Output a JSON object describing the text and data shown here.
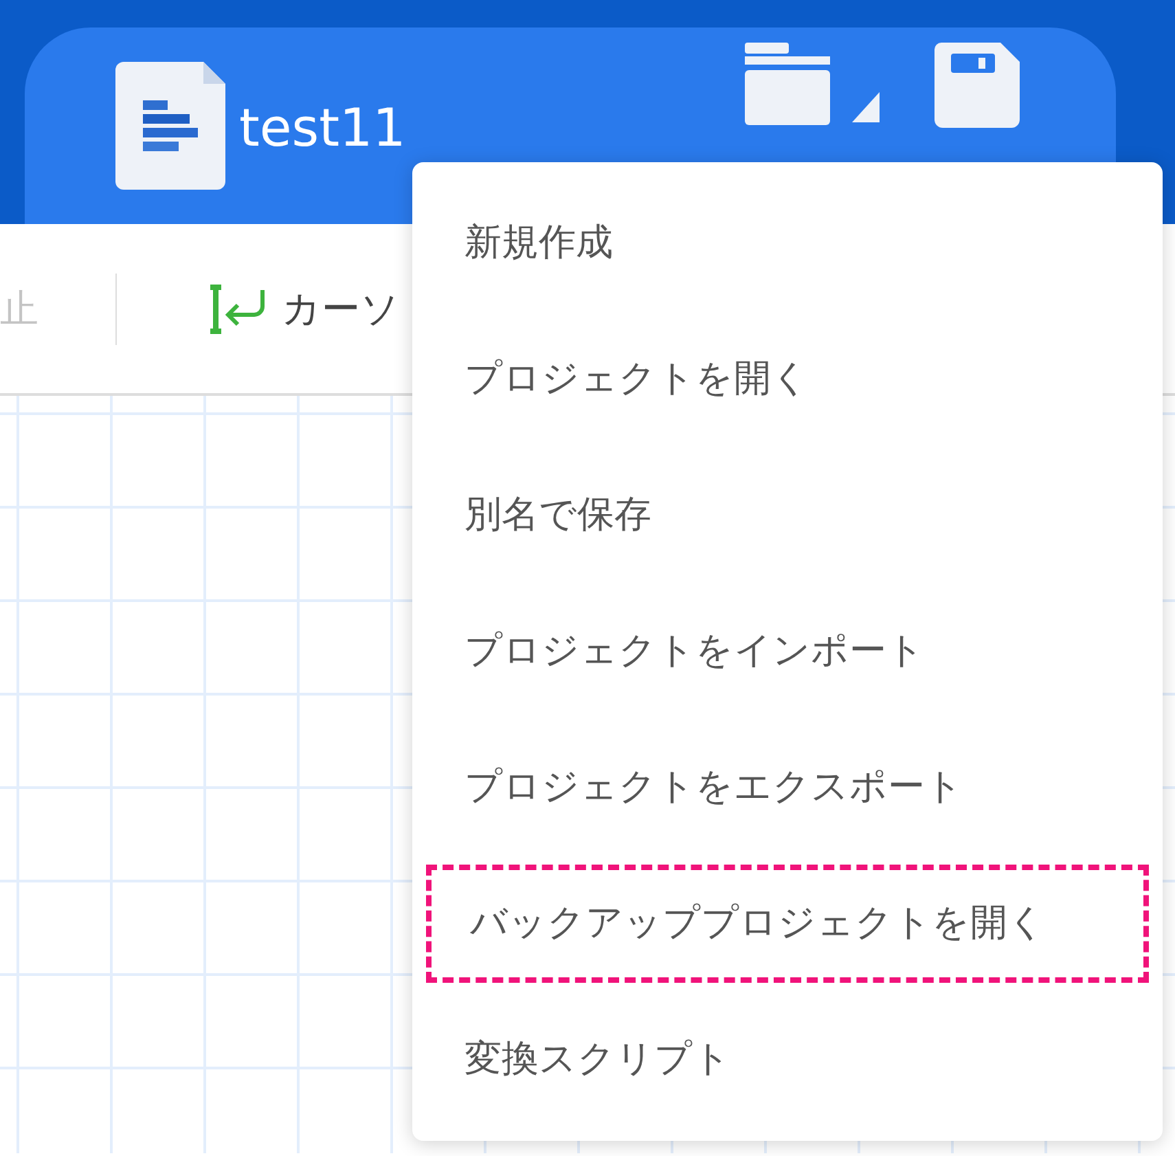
{
  "header": {
    "file_name": "test11",
    "buttons": [
      {
        "kind": "open"
      },
      {
        "kind": "save"
      }
    ]
  },
  "toolbar": {
    "items": [
      {
        "label": "止",
        "disabled": true
      },
      {
        "label": "カーソ",
        "disabled": false
      }
    ]
  },
  "menu": {
    "items": [
      {
        "label": "新規作成",
        "selected": false
      },
      {
        "label": "プロジェクトを開く",
        "selected": false
      },
      {
        "label": "別名で保存",
        "selected": false
      },
      {
        "label": "プロジェクトをインポート",
        "selected": false
      },
      {
        "label": "プロジェクトをエクスポート",
        "selected": false
      },
      {
        "label": "バックアッププロジェクトを開く",
        "selected": true
      },
      {
        "label": "変換スクリプト",
        "selected": false
      }
    ]
  }
}
